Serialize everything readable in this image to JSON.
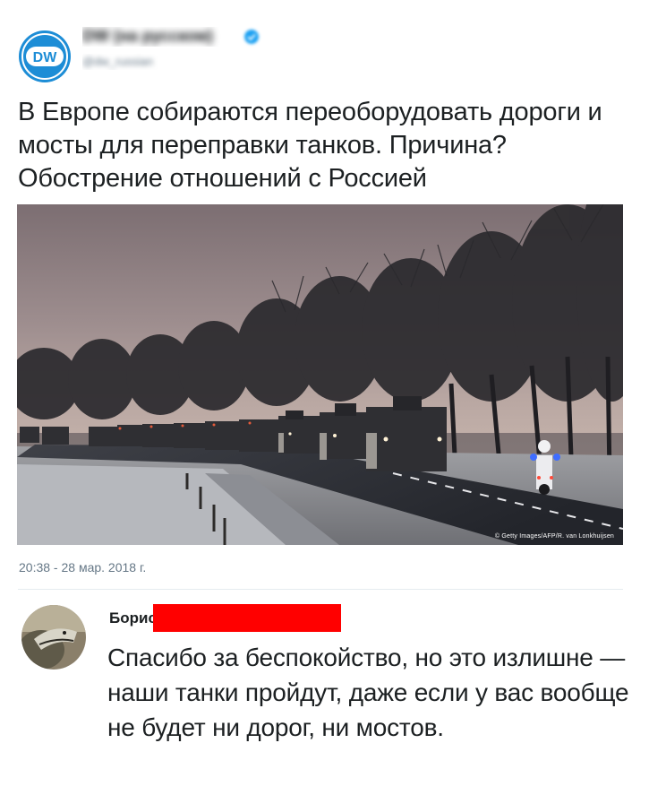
{
  "tweet": {
    "author": {
      "logo_text": "DW",
      "name": "DW (на русском)",
      "handle": "@dw_russian",
      "verified_icon": "verified-badge-icon",
      "brand_color": "#1d8dd6"
    },
    "text": "В Европе собираются переоборудовать дороги и мосты для переправки танков. Причина? Обострение отношений с Россией",
    "photo": {
      "credit": "© Getty Images/AFP/R. van Lonkhuijsen"
    },
    "timestamp": "20:38 - 28 мар. 2018 г."
  },
  "reply": {
    "author_name": "Борис",
    "redaction_color": "#ff0000",
    "text": "Спасибо за беспокойство, но это излишне — наши танки пройдут, даже если у вас вообще не будет ни дорог, ни мостов."
  }
}
